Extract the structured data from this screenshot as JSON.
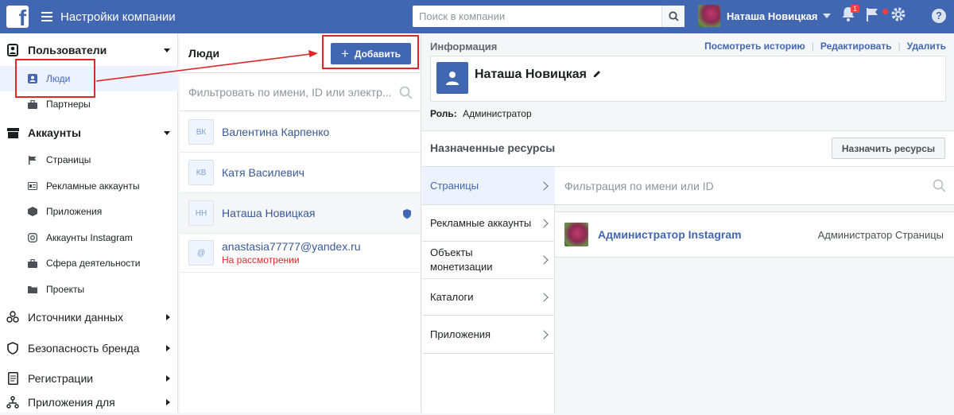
{
  "header": {
    "logo": "f",
    "title": "Настройки компании",
    "search_placeholder": "Поиск в компании",
    "user_name": "Наташа Новицкая",
    "notifications_count": "1",
    "help": "?"
  },
  "sidebar": {
    "sections": [
      {
        "label": "Пользователи",
        "icon": "users-icon"
      },
      {
        "label": "Аккаунты",
        "icon": "accounts-icon"
      },
      {
        "label": "Источники данных",
        "icon": "data-sources-icon"
      },
      {
        "label": "Безопасность бренда",
        "icon": "shield-icon"
      },
      {
        "label": "Регистрации",
        "icon": "registrations-icon"
      },
      {
        "label": "Приложения для",
        "icon": "integrations-icon"
      }
    ],
    "items": [
      {
        "label": "Люди",
        "icon": "person-icon"
      },
      {
        "label": "Партнеры",
        "icon": "briefcase-icon"
      },
      {
        "label": "Страницы",
        "icon": "flag-icon"
      },
      {
        "label": "Рекламные аккаунты",
        "icon": "ad-account-icon"
      },
      {
        "label": "Приложения",
        "icon": "cube-icon"
      },
      {
        "label": "Аккаунты Instagram",
        "icon": "instagram-icon"
      },
      {
        "label": "Сфера деятельности",
        "icon": "briefcase-icon"
      },
      {
        "label": "Проекты",
        "icon": "folder-icon"
      }
    ]
  },
  "people": {
    "title": "Люди",
    "add_label": "Добавить",
    "filter_placeholder": "Фильтровать по имени, ID или электр...",
    "list": [
      {
        "initials": "ВК",
        "name": "Валентина Карпенко"
      },
      {
        "initials": "КВ",
        "name": "Катя Василевич"
      },
      {
        "initials": "НН",
        "name": "Наташа Новицкая"
      },
      {
        "initials": "@",
        "name": "anastasia77777@yandex.ru",
        "status": "На рассмотрении"
      }
    ]
  },
  "info": {
    "label": "Информация",
    "links": [
      "Посмотреть историю",
      "Редактировать",
      "Удалить"
    ],
    "name": "Наташа Новицкая",
    "role_label": "Роль:",
    "role_value": "Администратор"
  },
  "resources": {
    "title": "Назначенные ресурсы",
    "assign_label": "Назначить ресурсы",
    "tabs": [
      "Страницы",
      "Рекламные аккаунты",
      "Объекты монетизации",
      "Каталоги",
      "Приложения"
    ],
    "filter_placeholder": "Фильтрация по имени или ID",
    "rows": [
      {
        "name": "Администратор Instagram",
        "role": "Администратор Страницы"
      }
    ]
  },
  "colors": {
    "brand": "#4267b2",
    "highlight": "#e02626"
  }
}
